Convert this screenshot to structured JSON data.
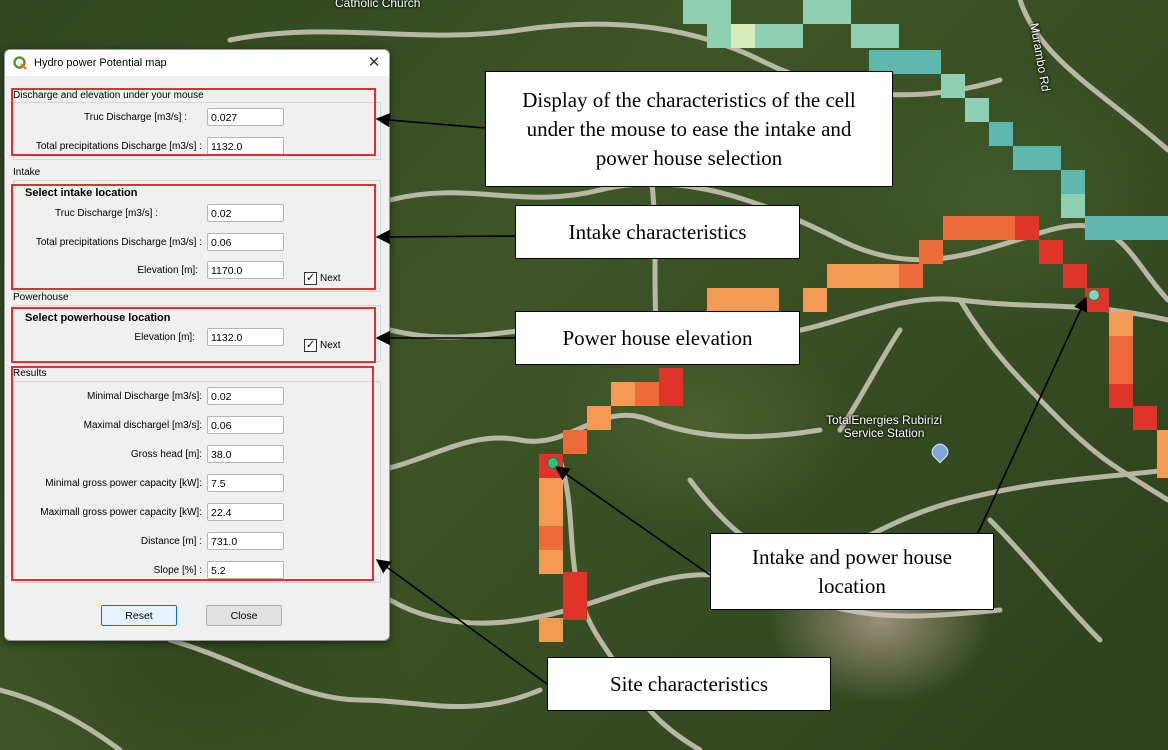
{
  "map": {
    "labels": {
      "church": "Catholic Church",
      "road": "Murambo Rd",
      "station": "TotalEnergies Rubirizi\nService Station"
    },
    "poi_icon": "fuel-station-pin-icon",
    "cell_colors": {
      "teal": "#5fb8b0",
      "light_teal": "#8fd0b4",
      "pale": "#d8ecb8",
      "orange": "#f39a55",
      "dark_orange": "#ee6a38",
      "red": "#e0342a"
    }
  },
  "dialog": {
    "title": "Hydro power Potential map",
    "logo_icon": "qgis-logo-icon",
    "close_icon": "close-icon",
    "sections": {
      "mouse": {
        "label": "Discharge and elevation under your mouse",
        "truc_label": "Truc Discharge [m3/s] :",
        "truc_value": "0.027",
        "precip_label": "Total precipitations Discharge [m3/s] :",
        "precip_value": "1132.0"
      },
      "intake": {
        "label": "Intake",
        "heading": "Select intake location",
        "truc_label": "Truc Discharge [m3/s] :",
        "truc_value": "0.02",
        "precip_label": "Total precipitations Discharge [m3/s] :",
        "precip_value": "0.06",
        "elev_label": "Elevation [m]:",
        "elev_value": "1170.0",
        "next_label": "Next",
        "next_checked": true
      },
      "powerhouse": {
        "label": "Powerhouse",
        "heading": "Select powerhouse location",
        "elev_label": "Elevation [m]:",
        "elev_value": "1132.0",
        "next_label": "Next",
        "next_checked": true
      },
      "results": {
        "label": "Results",
        "rows": [
          {
            "label": "Minimal Discharge [m3/s]:",
            "value": "0.02"
          },
          {
            "label": "Maximal dischargel [m3/s]:",
            "value": "0.06"
          },
          {
            "label": "Gross head [m]:",
            "value": "38.0"
          },
          {
            "label": "Minimal gross power capacity [kW]:",
            "value": "7.5"
          },
          {
            "label": "Maximall gross power capacity [kW]:",
            "value": "22.4"
          },
          {
            "label": "Distance [m] :",
            "value": "731.0"
          },
          {
            "label": "Slope [%] :",
            "value": "5.2"
          }
        ]
      }
    },
    "buttons": {
      "reset": "Reset",
      "close": "Close"
    }
  },
  "annotations": {
    "display": "Display of the characteristics of the cell under the mouse to ease the intake and power house selection",
    "intake": "Intake characteristics",
    "powerhouse": "Power house elevation",
    "location": "Intake and power house location",
    "site": "Site characteristics"
  },
  "colors": {
    "highlight_box": "#e03030",
    "dialog_bg": "#f0f0f0",
    "default_button_border": "#0078d7"
  }
}
